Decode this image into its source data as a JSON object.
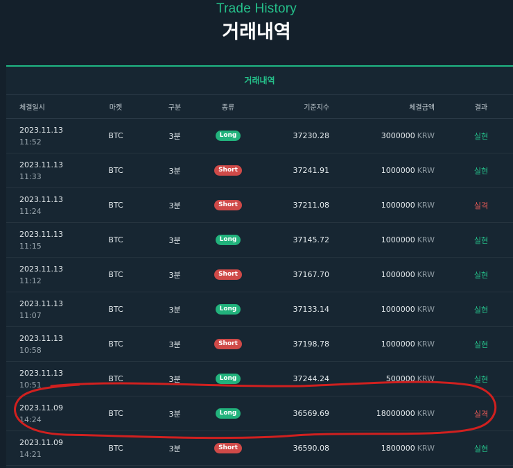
{
  "header": {
    "subtitle_en": "Trade History",
    "title_ko": "거래내역"
  },
  "panel": {
    "title": "거래내역"
  },
  "columns": {
    "datetime": "체결일시",
    "market": "마켓",
    "division": "구분",
    "kind": "종류",
    "index": "기준지수",
    "amount": "체결금액",
    "result": "결과"
  },
  "rows": [
    {
      "date": "2023.11.13",
      "time": "11:52",
      "market": "BTC",
      "division": "3분",
      "kind": "Long",
      "index": "37230.28",
      "amount": "3000000",
      "unit": "KRW",
      "result": "실현"
    },
    {
      "date": "2023.11.13",
      "time": "11:33",
      "market": "BTC",
      "division": "3분",
      "kind": "Short",
      "index": "37241.91",
      "amount": "1000000",
      "unit": "KRW",
      "result": "실현"
    },
    {
      "date": "2023.11.13",
      "time": "11:24",
      "market": "BTC",
      "division": "3분",
      "kind": "Short",
      "index": "37211.08",
      "amount": "1000000",
      "unit": "KRW",
      "result": "실격"
    },
    {
      "date": "2023.11.13",
      "time": "11:15",
      "market": "BTC",
      "division": "3분",
      "kind": "Long",
      "index": "37145.72",
      "amount": "1000000",
      "unit": "KRW",
      "result": "실현"
    },
    {
      "date": "2023.11.13",
      "time": "11:12",
      "market": "BTC",
      "division": "3분",
      "kind": "Short",
      "index": "37167.70",
      "amount": "1000000",
      "unit": "KRW",
      "result": "실현"
    },
    {
      "date": "2023.11.13",
      "time": "11:07",
      "market": "BTC",
      "division": "3분",
      "kind": "Long",
      "index": "37133.14",
      "amount": "1000000",
      "unit": "KRW",
      "result": "실현"
    },
    {
      "date": "2023.11.13",
      "time": "10:58",
      "market": "BTC",
      "division": "3분",
      "kind": "Short",
      "index": "37198.78",
      "amount": "1000000",
      "unit": "KRW",
      "result": "실현"
    },
    {
      "date": "2023.11.13",
      "time": "10:51",
      "market": "BTC",
      "division": "3분",
      "kind": "Long",
      "index": "37244.24",
      "amount": "500000",
      "unit": "KRW",
      "result": "실현"
    },
    {
      "date": "2023.11.09",
      "time": "14:24",
      "market": "BTC",
      "division": "3분",
      "kind": "Long",
      "index": "36569.69",
      "amount": "18000000",
      "unit": "KRW",
      "result": "실격"
    },
    {
      "date": "2023.11.09",
      "time": "14:21",
      "market": "BTC",
      "division": "3분",
      "kind": "Short",
      "index": "36590.08",
      "amount": "1800000",
      "unit": "KRW",
      "result": "실현"
    }
  ],
  "styles": {
    "accent": "#25c08a",
    "long_badge": "#22b27c",
    "short_badge": "#cf4a48",
    "loss_text": "#e65a57",
    "annotation_stroke": "#d0201f"
  }
}
